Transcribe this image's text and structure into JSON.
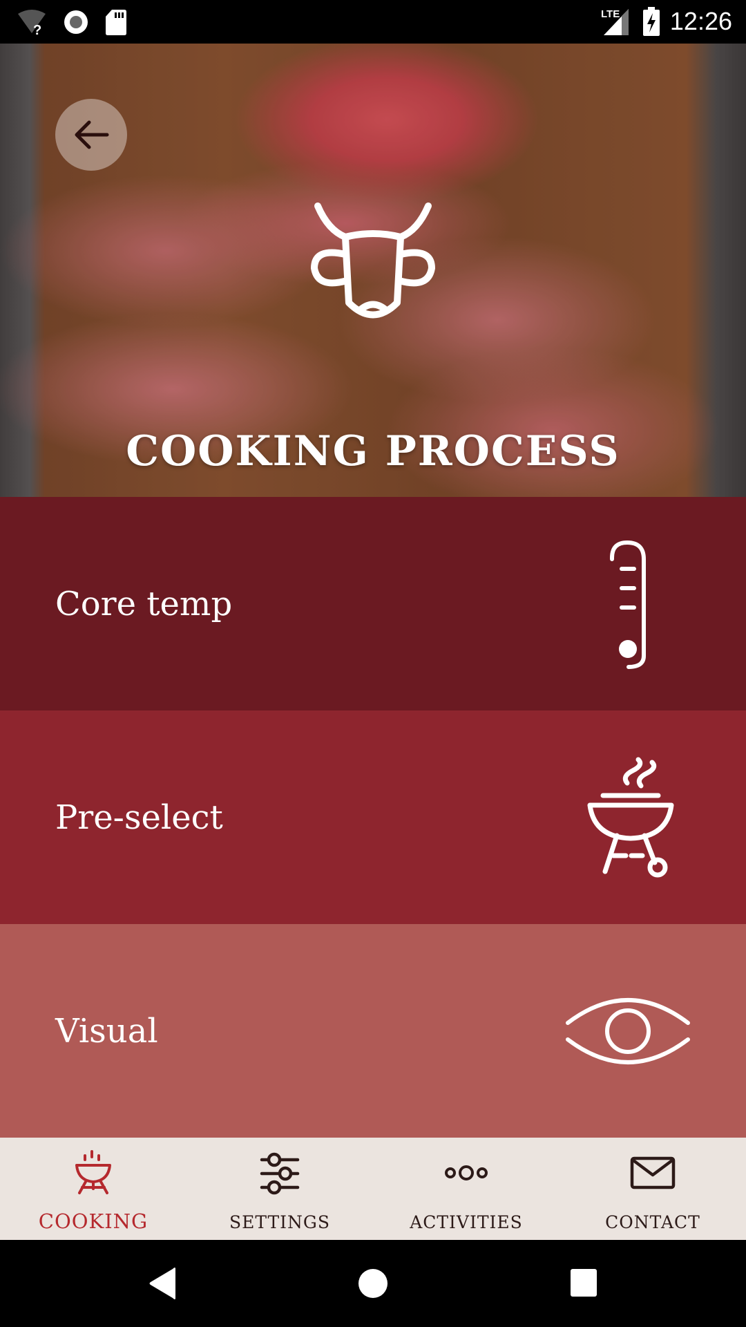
{
  "status_bar": {
    "time": "12:26",
    "network_label": "LTE",
    "icons": [
      "wifi-unknown-icon",
      "record-icon",
      "sd-card-icon",
      "lte-signal-icon",
      "battery-charging-icon"
    ]
  },
  "hero": {
    "title": "COOKING PROCESS",
    "icon": "cow-head-icon",
    "back_icon": "arrow-left-icon"
  },
  "options": [
    {
      "label": "Core temp",
      "icon": "thermometer-icon",
      "color": "#6b1a22"
    },
    {
      "label": "Pre-select",
      "icon": "grill-icon",
      "color": "#8e252e"
    },
    {
      "label": "Visual",
      "icon": "eye-icon",
      "color": "#b05a56"
    }
  ],
  "bottom_nav": {
    "active_color": "#b5292e",
    "items": [
      {
        "label": "COOKING",
        "icon": "grill-icon",
        "active": true
      },
      {
        "label": "SETTINGS",
        "icon": "sliders-icon",
        "active": false
      },
      {
        "label": "ACTIVITIES",
        "icon": "three-circles-icon",
        "active": false
      },
      {
        "label": "CONTACT",
        "icon": "envelope-icon",
        "active": false
      }
    ]
  },
  "system_nav": {
    "buttons": [
      "back-triangle-icon",
      "home-circle-icon",
      "recents-square-icon"
    ]
  }
}
